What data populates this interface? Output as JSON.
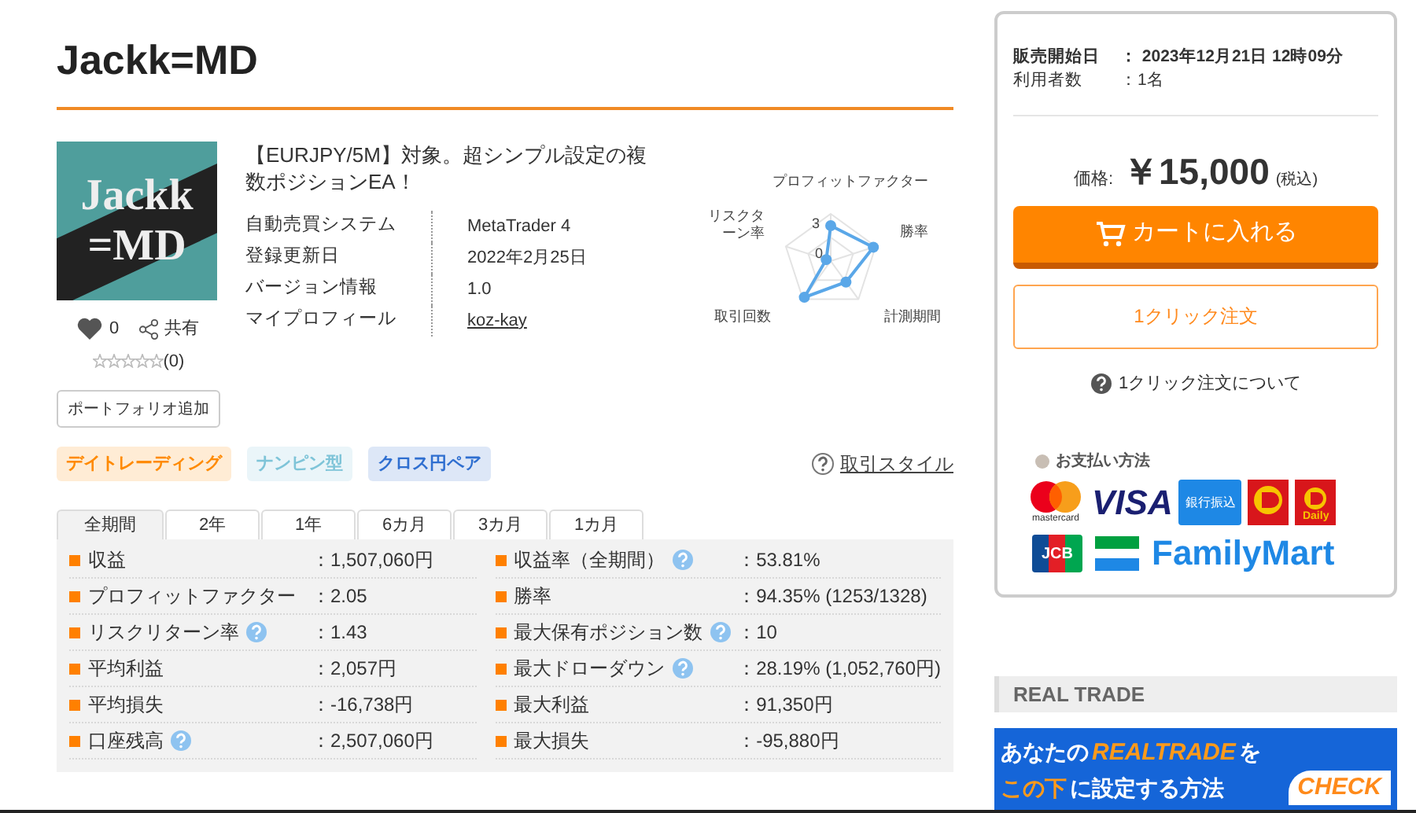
{
  "title": "Jackk=MD",
  "product": {
    "logo_lines": [
      "Jackk",
      "=MD"
    ],
    "headline": "【EURJPY/5M】対象。超シンプル設定の複数ポジションEA！",
    "specs": [
      {
        "label": "自動売買システム",
        "value": "MetaTrader 4",
        "kind": "text"
      },
      {
        "label": "登録更新日",
        "value": "2022年2月25日",
        "kind": "text"
      },
      {
        "label": "バージョン情報",
        "value": "1.0",
        "kind": "text"
      },
      {
        "label": "マイプロフィール",
        "value": "koz-kay",
        "kind": "link"
      }
    ],
    "likes": "0",
    "share": "共有",
    "stars": 0,
    "review_count": "(0)",
    "portfolio_button": "ポートフォリオ追加"
  },
  "radar": {
    "axes": [
      "プロフィットファクター",
      "勝率",
      "計測期間",
      "取引回数",
      "リスクターン率"
    ],
    "ticks": [
      "3",
      "0"
    ]
  },
  "tags": [
    {
      "label": "デイトレーディング",
      "color": "#ff8a00"
    },
    {
      "label": "ナンピン型",
      "color": "#7ec4d8"
    },
    {
      "label": "クロス円ペア",
      "color": "#2f6fd0"
    }
  ],
  "style_link": "取引スタイル",
  "tabs": [
    {
      "label": "全期間",
      "selected": true
    },
    {
      "label": "2年",
      "selected": false
    },
    {
      "label": "1年",
      "selected": false
    },
    {
      "label": "6カ月",
      "selected": false
    },
    {
      "label": "3カ月",
      "selected": false
    },
    {
      "label": "1カ月",
      "selected": false
    }
  ],
  "stats_left": [
    {
      "label": "収益",
      "value": "：1,507,060円",
      "help": false
    },
    {
      "label": "プロフィットファクター",
      "value": "：2.05",
      "help": false
    },
    {
      "label": "リスクリターン率",
      "value": "：1.43",
      "help": true
    },
    {
      "label": "平均利益",
      "value": "：2,057円",
      "help": false
    },
    {
      "label": "平均損失",
      "value": "：-16,738円",
      "help": false
    },
    {
      "label": "口座残高",
      "value": "：2,507,060円",
      "help": true
    }
  ],
  "stats_right": [
    {
      "label": "収益率（全期間）",
      "value": "：53.81%",
      "help": true
    },
    {
      "label": "勝率",
      "value": "：94.35% (1253/1328)",
      "help": false
    },
    {
      "label": "最大保有ポジション数",
      "value": "：10",
      "help": true
    },
    {
      "label": "最大ドローダウン",
      "value": "：28.19% (1,052,760円)",
      "help": true
    },
    {
      "label": "最大利益",
      "value": "：91,350円",
      "help": false
    },
    {
      "label": "最大損失",
      "value": "：-95,880円",
      "help": false
    }
  ],
  "sale": {
    "rows": [
      {
        "label": "販売開始日",
        "value": "： 2023年12月21日 12時09分",
        "bold": true
      },
      {
        "label": "利用者数",
        "value": "：1名",
        "bold": false
      }
    ],
    "price_label": "価格:",
    "price": "￥15,000",
    "tax": "(税込)",
    "cart_button": "カートに入れる",
    "one_click_button": "1クリック注文",
    "one_click_help": "1クリック注文について"
  },
  "payment": {
    "title": "お支払い方法",
    "methods": [
      {
        "kind": "mastercard",
        "label": "mastercard"
      },
      {
        "kind": "visa",
        "label": "VISA"
      },
      {
        "kind": "bank",
        "label": "銀行振込"
      },
      {
        "kind": "daily-yamazaki"
      },
      {
        "kind": "daily",
        "label": "Daily"
      },
      {
        "kind": "jcb",
        "label": "JCB"
      },
      {
        "kind": "familymart",
        "label": "FamilyMart"
      }
    ]
  },
  "real_trade": {
    "heading": "REAL TRADE",
    "banner_line1": [
      "あなたの",
      "REALTRADE",
      "を"
    ],
    "banner_line2": [
      "この下",
      "に設定する方法"
    ],
    "banner_cta": "CHECK"
  }
}
